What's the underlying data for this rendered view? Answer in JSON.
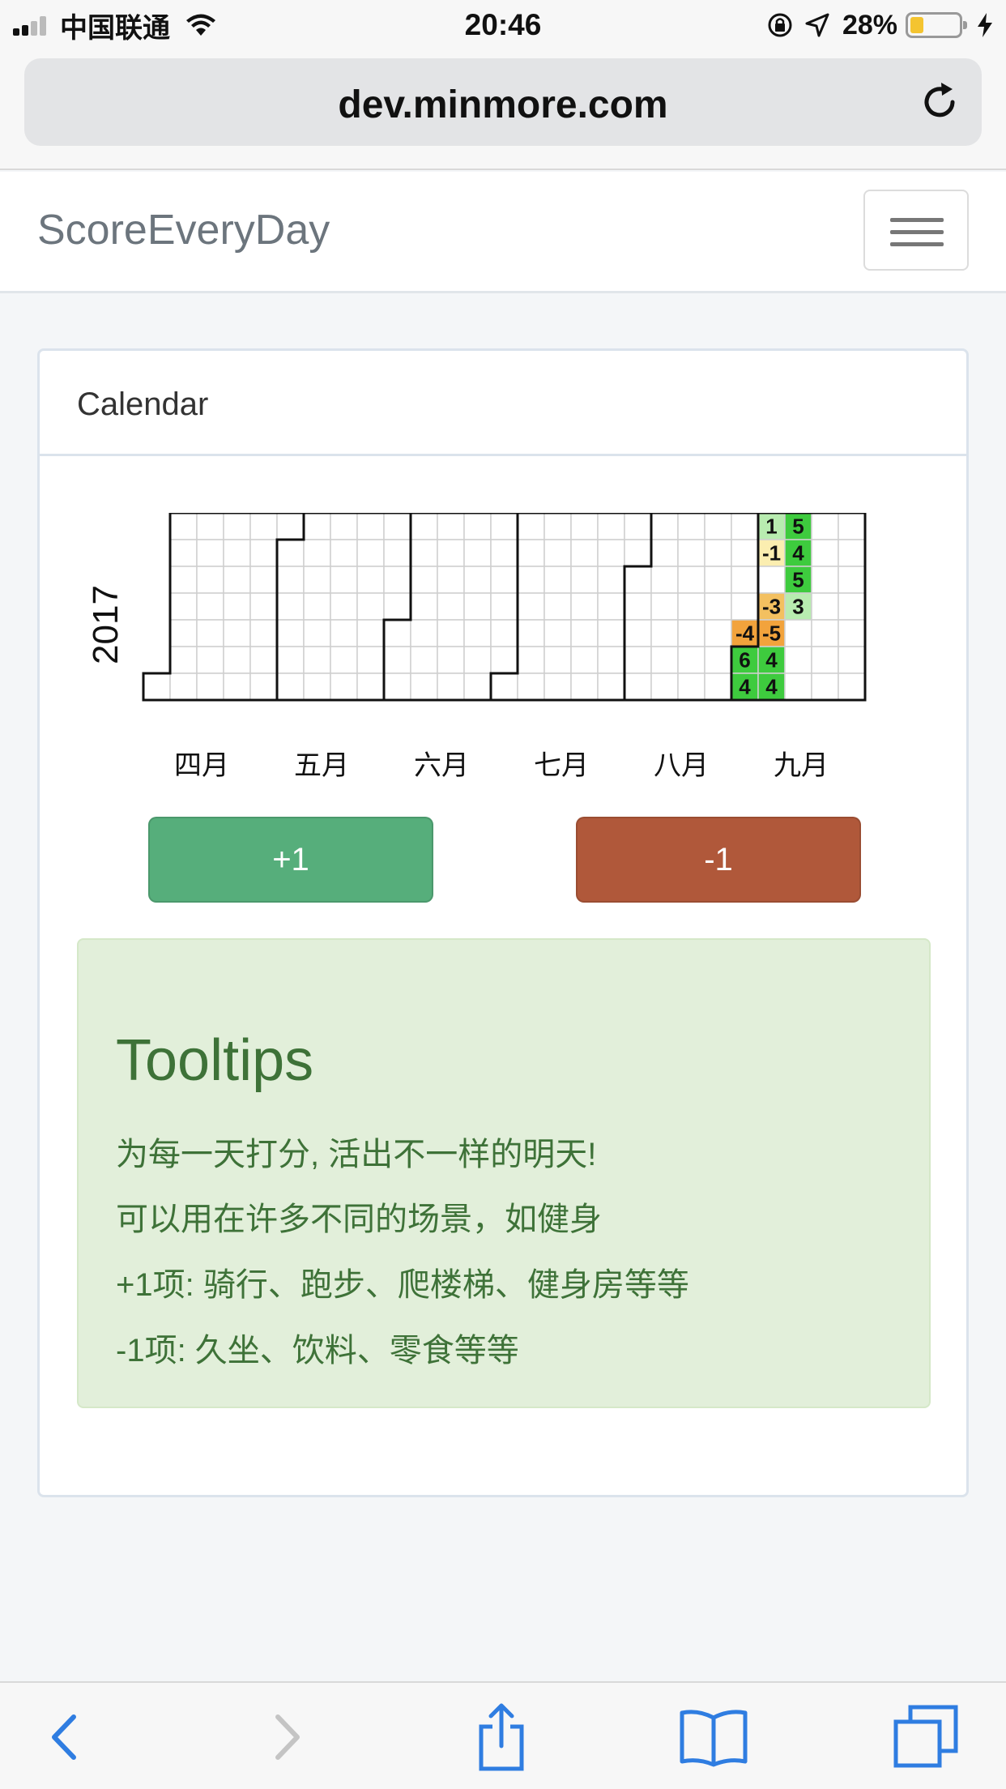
{
  "status_bar": {
    "carrier": "中国联通",
    "time": "20:46",
    "battery_pct": "28%",
    "battery_level": 0.28
  },
  "browser": {
    "url": "dev.minmore.com"
  },
  "navbar": {
    "brand": "ScoreEveryDay"
  },
  "card": {
    "title": "Calendar"
  },
  "calendar": {
    "year": "2017",
    "months": [
      "四月",
      "五月",
      "六月",
      "七月",
      "八月",
      "九月"
    ],
    "scored_days": [
      {
        "date": "2017-09-01",
        "score": "6",
        "color": "#3ecb3e"
      },
      {
        "date": "2017-09-08",
        "score": "4",
        "color": "#3ecb3e"
      },
      {
        "date": "2017-09-02",
        "score": "4",
        "color": "#3ecb3e"
      },
      {
        "date": "2017-09-09",
        "score": "4",
        "color": "#3ecb3e"
      },
      {
        "date": "2017-09-03",
        "score": "1",
        "color": "#b8ecb0"
      },
      {
        "date": "2017-09-10",
        "score": "5",
        "color": "#3ecb3e"
      },
      {
        "date": "2017-09-04",
        "score": "-1",
        "color": "#fbeeb0"
      },
      {
        "date": "2017-09-11",
        "score": "4",
        "color": "#3ecb3e"
      },
      {
        "date": "2017-09-12",
        "score": "5",
        "color": "#3ecb3e"
      },
      {
        "date": "2017-09-06",
        "score": "-3",
        "color": "#f3c060"
      },
      {
        "date": "2017-09-13",
        "score": "3",
        "color": "#b8ecb0"
      },
      {
        "date": "2017-08-31",
        "score": "-4",
        "color": "#f2a33c"
      },
      {
        "date": "2017-09-07",
        "score": "-5",
        "color": "#f2a33c"
      }
    ]
  },
  "buttons": {
    "plus_label": "+1",
    "minus_label": "-1",
    "plus_color": "#56ae7b",
    "minus_color": "#b0583a"
  },
  "tooltips": {
    "heading": "Tooltips",
    "lines": [
      "为每一天打分, 活出不一样的明天!",
      "可以用在许多不同的场景，如健身",
      "+1项: 骑行、跑步、爬楼梯、健身房等等",
      "-1项: 久坐、饮料、零食等等"
    ]
  },
  "toolbar": {
    "items": [
      "back-icon",
      "forward-icon",
      "share-icon",
      "bookmarks-icon",
      "tabs-icon"
    ]
  }
}
